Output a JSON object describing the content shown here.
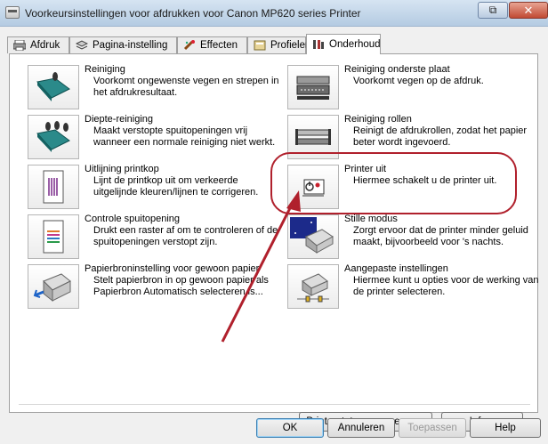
{
  "window": {
    "title": "Voorkeursinstellingen voor afdrukken voor Canon MP620 series Printer",
    "restore_glyph": "⧉",
    "close_glyph": "✕"
  },
  "tabs": [
    {
      "label": "Afdruk",
      "icon": "print-icon"
    },
    {
      "label": "Pagina-instelling",
      "icon": "page-setup-icon"
    },
    {
      "label": "Effecten",
      "icon": "effects-icon"
    },
    {
      "label": "Profielen",
      "icon": "profiles-icon"
    },
    {
      "label": "Onderhoud",
      "icon": "maintenance-icon",
      "active": true
    }
  ],
  "maintenance": {
    "left": [
      {
        "title": "Reiniging",
        "desc": "Voorkomt ongewenste vegen en strepen in het afdrukresultaat.",
        "icon": "cleaning-icon"
      },
      {
        "title": "Diepte-reiniging",
        "desc": "Maakt verstopte spuitopeningen vrij wanneer een normale reiniging niet werkt.",
        "icon": "deep-cleaning-icon"
      },
      {
        "title": "Uitlijning printkop",
        "desc": "Lijnt de printkop uit om verkeerde uitgelijnde kleuren/lijnen te corrigeren.",
        "icon": "print-head-alignment-icon"
      },
      {
        "title": "Controle spuitopening",
        "desc": "Drukt een raster af om te controleren of de spuitopeningen verstopt zijn.",
        "icon": "nozzle-check-icon"
      },
      {
        "title": "Papierbroninstelling voor gewoon papier",
        "desc": "Stelt papierbron in op gewoon papier als Papierbron Automatisch selecteren is...",
        "icon": "paper-source-icon"
      }
    ],
    "right": [
      {
        "title": "Reiniging onderste plaat",
        "desc": "Voorkomt vegen op de afdruk.",
        "icon": "bottom-plate-cleaning-icon"
      },
      {
        "title": "Reiniging rollen",
        "desc": "Reinigt de afdrukrollen, zodat het papier beter wordt ingevoerd.",
        "icon": "roller-cleaning-icon"
      },
      {
        "title": "Printer uit",
        "desc": "Hiermee schakelt u de printer uit.",
        "icon": "power-off-icon"
      },
      {
        "title": "Stille modus",
        "desc": "Zorgt ervoor dat de printer minder geluid maakt, bijvoorbeeld voor 's nachts.",
        "icon": "quiet-mode-icon"
      },
      {
        "title": "Aangepaste instellingen",
        "desc": "Hiermee kunt u opties voor de werking van de printer selecteren.",
        "icon": "custom-settings-icon"
      }
    ]
  },
  "panel_buttons": {
    "status": "Printerstatus weergeven...",
    "info": "Info..."
  },
  "footer_buttons": {
    "ok": "OK",
    "cancel": "Annuleren",
    "apply": "Toepassen",
    "help": "Help"
  },
  "colors": {
    "annotation": "#b0202c",
    "title_bar": "#bfd3e6",
    "close_button": "#c14a33"
  }
}
